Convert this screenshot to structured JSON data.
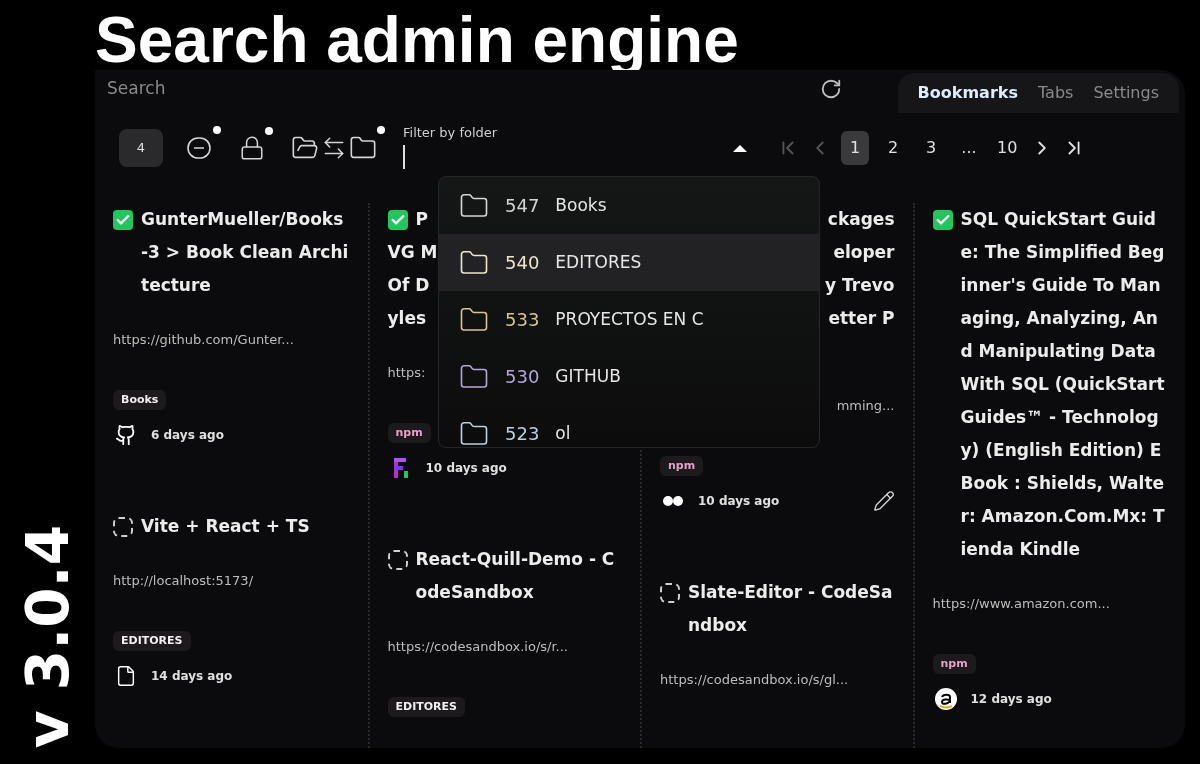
{
  "headline": "Search admin engine",
  "version": "v 3.0.4",
  "search": {
    "placeholder": "Search"
  },
  "tabs": [
    {
      "label": "Bookmarks",
      "selected": true
    },
    {
      "label": "Tabs",
      "selected": false
    },
    {
      "label": "Settings",
      "selected": false
    }
  ],
  "count": "4",
  "toolbar": [
    {
      "kind": "minus",
      "dot": true
    },
    {
      "kind": "lock",
      "dot": true
    },
    {
      "kind": "swap",
      "dot": true
    }
  ],
  "filter": {
    "label": "Filter by folder"
  },
  "pages": [
    {
      "label": "1",
      "selected": true
    },
    {
      "label": "2",
      "selected": false
    },
    {
      "label": "3",
      "selected": false
    },
    {
      "label": "...",
      "selected": false
    },
    {
      "label": "10",
      "selected": false
    }
  ],
  "columns": [
    {
      "cards": [
        {
          "kind": "full",
          "checked": true,
          "title": "GunterMueller/Books-3 > Book Clean Architecture",
          "url": "https://github.com/Gunter...",
          "tag": {
            "label": "Books",
            "color": "#f0f0f0"
          },
          "meta": {
            "kind": "github",
            "time": "6 days ago"
          }
        },
        {
          "kind": "full",
          "checked": false,
          "title": "Vite + React + TS",
          "url": "http://localhost:5173/",
          "tag": {
            "label": "EDITORES",
            "color": "#f0f0f0"
          },
          "meta": {
            "kind": "file",
            "time": "14 days ago"
          }
        }
      ]
    },
    {
      "cards": [
        {
          "kind": "right",
          "checked": true,
          "title_lines": [
            "P",
            "VG M",
            "Of D",
            "yles"
          ],
          "url": "https:",
          "tag": {
            "label": "npm",
            "color": "#e8a0c8"
          },
          "meta": {
            "kind": "letter",
            "time": "10 days ago"
          }
        },
        {
          "kind": "full",
          "checked": false,
          "title": "React-Quill-Demo - CodeSandbox",
          "url": "https://codesandbox.io/s/r...",
          "tag": {
            "label": "EDITORES",
            "color": "#f0f0f0"
          }
        }
      ]
    },
    {
      "cards": [
        {
          "kind": "left",
          "title_lines": [
            "ckages",
            "eloper",
            "y Trevo",
            "etter P"
          ],
          "url": "mming...",
          "tag": {
            "label": "npm",
            "color": "#e8a0c8"
          },
          "meta": {
            "kind": "dots",
            "time": "10 days ago"
          },
          "editable": true
        },
        {
          "kind": "full",
          "checked": false,
          "title": "Slate-Editor - CodeSandbox",
          "url": "https://codesandbox.io/s/gl..."
        }
      ]
    },
    {
      "cards": [
        {
          "kind": "full",
          "checked": true,
          "title": "SQL QuickStart Guide: The Simplified Beginner's Guide To Managing, Analyzing, And Manipulating Data With SQL (QuickStart Guides™ - Technology) (English Edition) EBook : Shields, Walter: Amazon.Com.Mx: Tienda Kindle",
          "url": "https://www.amazon.com...",
          "tag": {
            "label": "npm",
            "color": "#e8a0c8"
          },
          "meta": {
            "kind": "amazon",
            "time": "12 days ago"
          }
        }
      ]
    }
  ],
  "folders": [
    {
      "count": "547",
      "name": "Books",
      "color": "#d4d4d4",
      "highlighted": false
    },
    {
      "count": "540",
      "name": "EDITORES",
      "color": "#ece6cf",
      "highlighted": true
    },
    {
      "count": "533",
      "name": "PROYECTOS EN C",
      "color": "#d9c48c",
      "highlighted": false
    },
    {
      "count": "530",
      "name": "GITHUB",
      "color": "#b6a6d6",
      "highlighted": false
    },
    {
      "count": "523",
      "name": "ol",
      "color": "#b8d0e0",
      "highlighted": false
    }
  ]
}
